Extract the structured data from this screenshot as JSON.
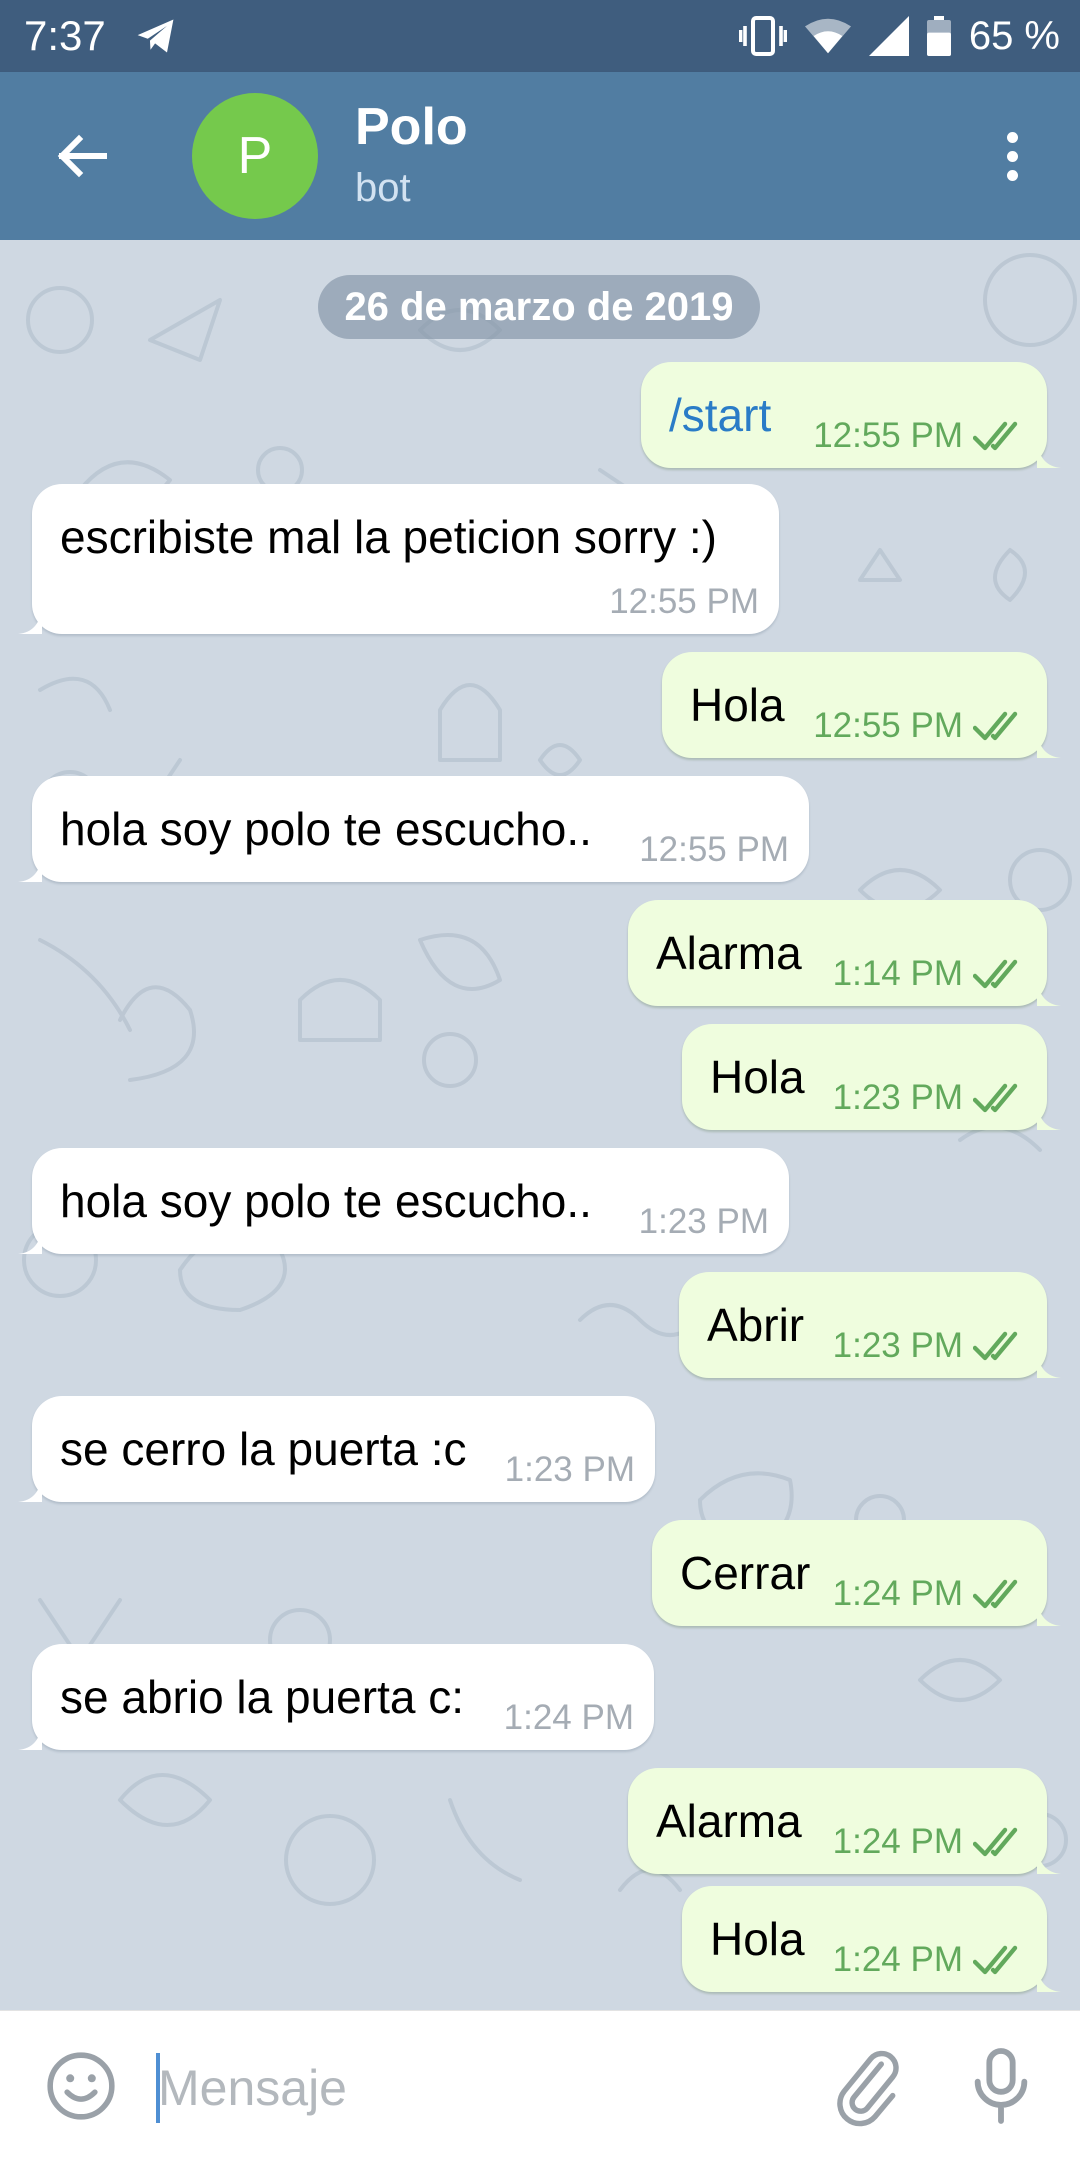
{
  "status_bar": {
    "time": "7:37",
    "battery": "65 %",
    "icons": [
      "telegram-icon",
      "vibrate-icon",
      "wifi-icon",
      "signal-icon",
      "battery-icon"
    ]
  },
  "header": {
    "avatar_letter": "P",
    "title": "Polo",
    "subtitle": "bot",
    "icons": [
      "back-arrow-icon",
      "more-vertical-icon"
    ]
  },
  "chat": {
    "date": "26 de marzo de 2019",
    "messages": [
      {
        "direction": "out",
        "text": "/start",
        "time": "12:55 PM",
        "status": "read"
      },
      {
        "direction": "in",
        "text": "escribiste mal la peticion sorry :)",
        "time": "12:55 PM"
      },
      {
        "direction": "out",
        "text": "Hola",
        "time": "12:55 PM",
        "status": "read"
      },
      {
        "direction": "in",
        "text": "hola soy polo te escucho..",
        "time": "12:55 PM"
      },
      {
        "direction": "out",
        "text": "Alarma",
        "time": "1:14 PM",
        "status": "read"
      },
      {
        "direction": "out",
        "text": "Hola",
        "time": "1:23 PM",
        "status": "read"
      },
      {
        "direction": "in",
        "text": "hola soy polo te escucho..",
        "time": "1:23 PM"
      },
      {
        "direction": "out",
        "text": "Abrir",
        "time": "1:23 PM",
        "status": "read"
      },
      {
        "direction": "in",
        "text": "se cerro la puerta :c",
        "time": "1:23 PM"
      },
      {
        "direction": "out",
        "text": "Cerrar",
        "time": "1:24 PM",
        "status": "read"
      },
      {
        "direction": "in",
        "text": "se abrio la puerta c:",
        "time": "1:24 PM"
      },
      {
        "direction": "out",
        "text": "Alarma",
        "time": "1:24 PM",
        "status": "read"
      },
      {
        "direction": "out",
        "text": "Hola",
        "time": "1:24 PM",
        "status": "read"
      }
    ]
  },
  "composer": {
    "placeholder": "Mensaje",
    "icons": [
      "emoji-icon",
      "paperclip-icon",
      "microphone-icon"
    ]
  },
  "colors": {
    "status_bar": "#3f5d7e",
    "header": "#517da2",
    "avatar": "#75c94c",
    "chat_background": "#cfd8e2",
    "outgoing_bubble": "#effdde",
    "incoming_bubble": "#ffffff",
    "outgoing_time": "#62a95c",
    "command_link": "#2a7cc7"
  }
}
